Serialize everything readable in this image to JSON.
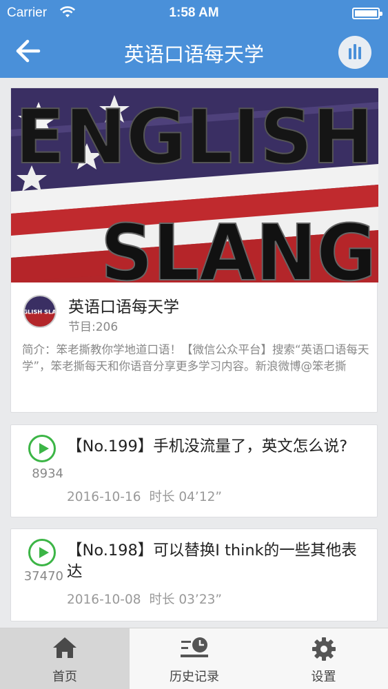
{
  "status_bar": {
    "carrier": "Carrier",
    "time": "1:58 AM"
  },
  "nav": {
    "title": "英语口语每天学",
    "back_icon": "arrow-left-icon",
    "player_icon": "audio-bars-icon"
  },
  "podcast": {
    "banner_text": [
      "ENGLISH",
      "SLANG"
    ],
    "avatar_text": "ENGLISH SLANG",
    "name": "英语口语每天学",
    "episode_count": "节目:206",
    "description": "简介：笨老撕教你学地道口语！【微信公众平台】搜索“英语口语每天学”，笨老撕每天和你语音分享更多学习内容。新浪微博@笨老撕"
  },
  "episodes": [
    {
      "plays": "8934",
      "title": "【No.199】手机没流量了，英文怎么说?",
      "date": "2016-10-16",
      "duration": "时长 04’12”"
    },
    {
      "plays": "37470",
      "title": "【No.198】可以替换I think的一些其他表达",
      "date": "2016-10-08",
      "duration": "时长 03’23”"
    }
  ],
  "tabs": [
    {
      "label": "首页",
      "icon": "home-icon",
      "active": true
    },
    {
      "label": "历史记录",
      "icon": "history-icon",
      "active": false
    },
    {
      "label": "设置",
      "icon": "gear-icon",
      "active": false
    }
  ],
  "colors": {
    "nav_blue": "#4a90d9",
    "play_green": "#3cb546",
    "page_bg": "#e9eaec"
  }
}
